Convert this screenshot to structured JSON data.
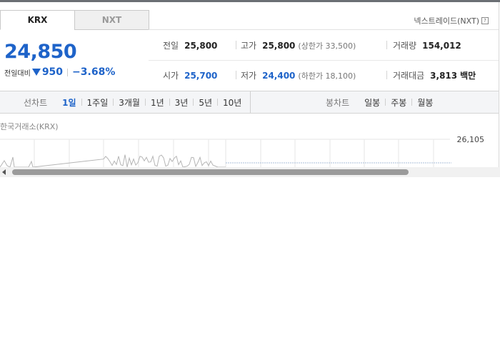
{
  "tabs": [
    {
      "label": "KRX",
      "active": true
    },
    {
      "label": "NXT",
      "active": false
    }
  ],
  "nxt_link": "넥스트레이드(NXT)",
  "price": {
    "current": "24,850",
    "change_label": "전일대비",
    "change_value": "950",
    "change_rate": "−3.68%",
    "direction": "down"
  },
  "stats": {
    "prev_close": {
      "label": "전일",
      "value": "25,800"
    },
    "high": {
      "label": "고가",
      "value": "25,800",
      "sub": "(상한가 33,500)"
    },
    "volume": {
      "label": "거래량",
      "value": "154,012"
    },
    "open": {
      "label": "시가",
      "value": "25,700"
    },
    "low": {
      "label": "저가",
      "value": "24,400",
      "sub": "(하한가 18,100)"
    },
    "amount": {
      "label": "거래대금",
      "value": "3,813",
      "unit": "백만"
    }
  },
  "toolbar": {
    "line_title": "선차트",
    "periods": [
      "1일",
      "1주일",
      "3개월",
      "1년",
      "3년",
      "5년",
      "10년"
    ],
    "active_period": "1일",
    "candle_title": "봉차트",
    "candles": [
      "일봉",
      "주봉",
      "월봉"
    ]
  },
  "chart": {
    "market_label": "한국거래소(KRX)",
    "y_max_label": "26,105"
  },
  "colors": {
    "down": "#1e63c9",
    "text": "#222222",
    "toolbar_bg": "#f4f5f7",
    "grid": "#e6e6e6"
  }
}
